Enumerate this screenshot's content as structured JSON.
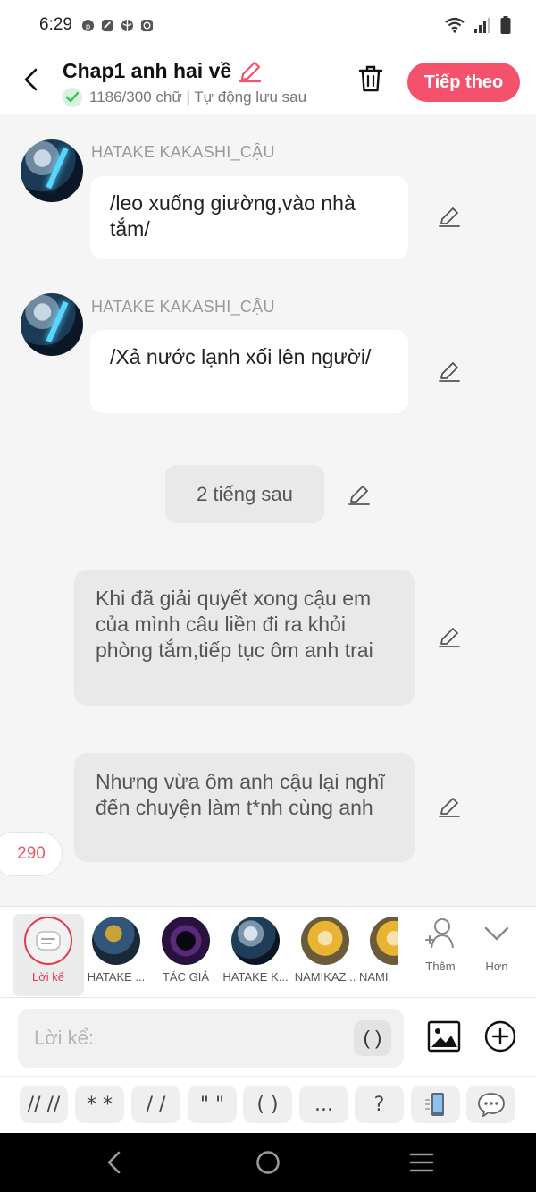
{
  "status": {
    "time": "6:29",
    "icons_left": [
      "pinterest-icon",
      "app-icon",
      "app-icon",
      "app-icon"
    ],
    "icons_right": [
      "wifi-icon",
      "signal-icon",
      "battery-icon"
    ]
  },
  "header": {
    "title": "Chap1 anh hai về",
    "subtitle": "1186/300 chữ | Tự động lưu sau",
    "next_label": "Tiếp theo"
  },
  "messages": [
    {
      "type": "dialogue",
      "speaker": "HATAKE KAKASHI_CẬU",
      "text": "/leo xuống giường,vào nhà tắm/"
    },
    {
      "type": "dialogue",
      "speaker": "HATAKE KAKASHI_CẬU",
      "text": "/Xả nước lạnh xối lên người/"
    },
    {
      "type": "time",
      "text": "2 tiếng sau"
    },
    {
      "type": "narration",
      "text": "Khi đã giải quyết xong cậu em của mình câu liền đi ra khỏi phòng tắm,tiếp tục ôm anh trai"
    },
    {
      "type": "narration",
      "text": "Nhưng vừa ôm anh cậu lại nghĩ đến chuyện làm t*nh cùng anh"
    }
  ],
  "badge_count": "290",
  "characters": [
    {
      "label": "Lời kể",
      "selected": true
    },
    {
      "label": "HATAKE ..."
    },
    {
      "label": "TÁC GIẢ"
    },
    {
      "label": "HATAKE K..."
    },
    {
      "label": "NAMIKAZ..."
    },
    {
      "label": "NAMI"
    }
  ],
  "tools": {
    "add_label": "Thêm",
    "more_label": "Hơn"
  },
  "input": {
    "placeholder": "Lời kể:",
    "paren_label": "( )"
  },
  "shortcuts": [
    "// //",
    "* *",
    "/ /",
    "\" \"",
    "( )",
    "...",
    "?"
  ],
  "colors": {
    "accent": "#f4516c",
    "accent_text": "#e23a4e"
  }
}
